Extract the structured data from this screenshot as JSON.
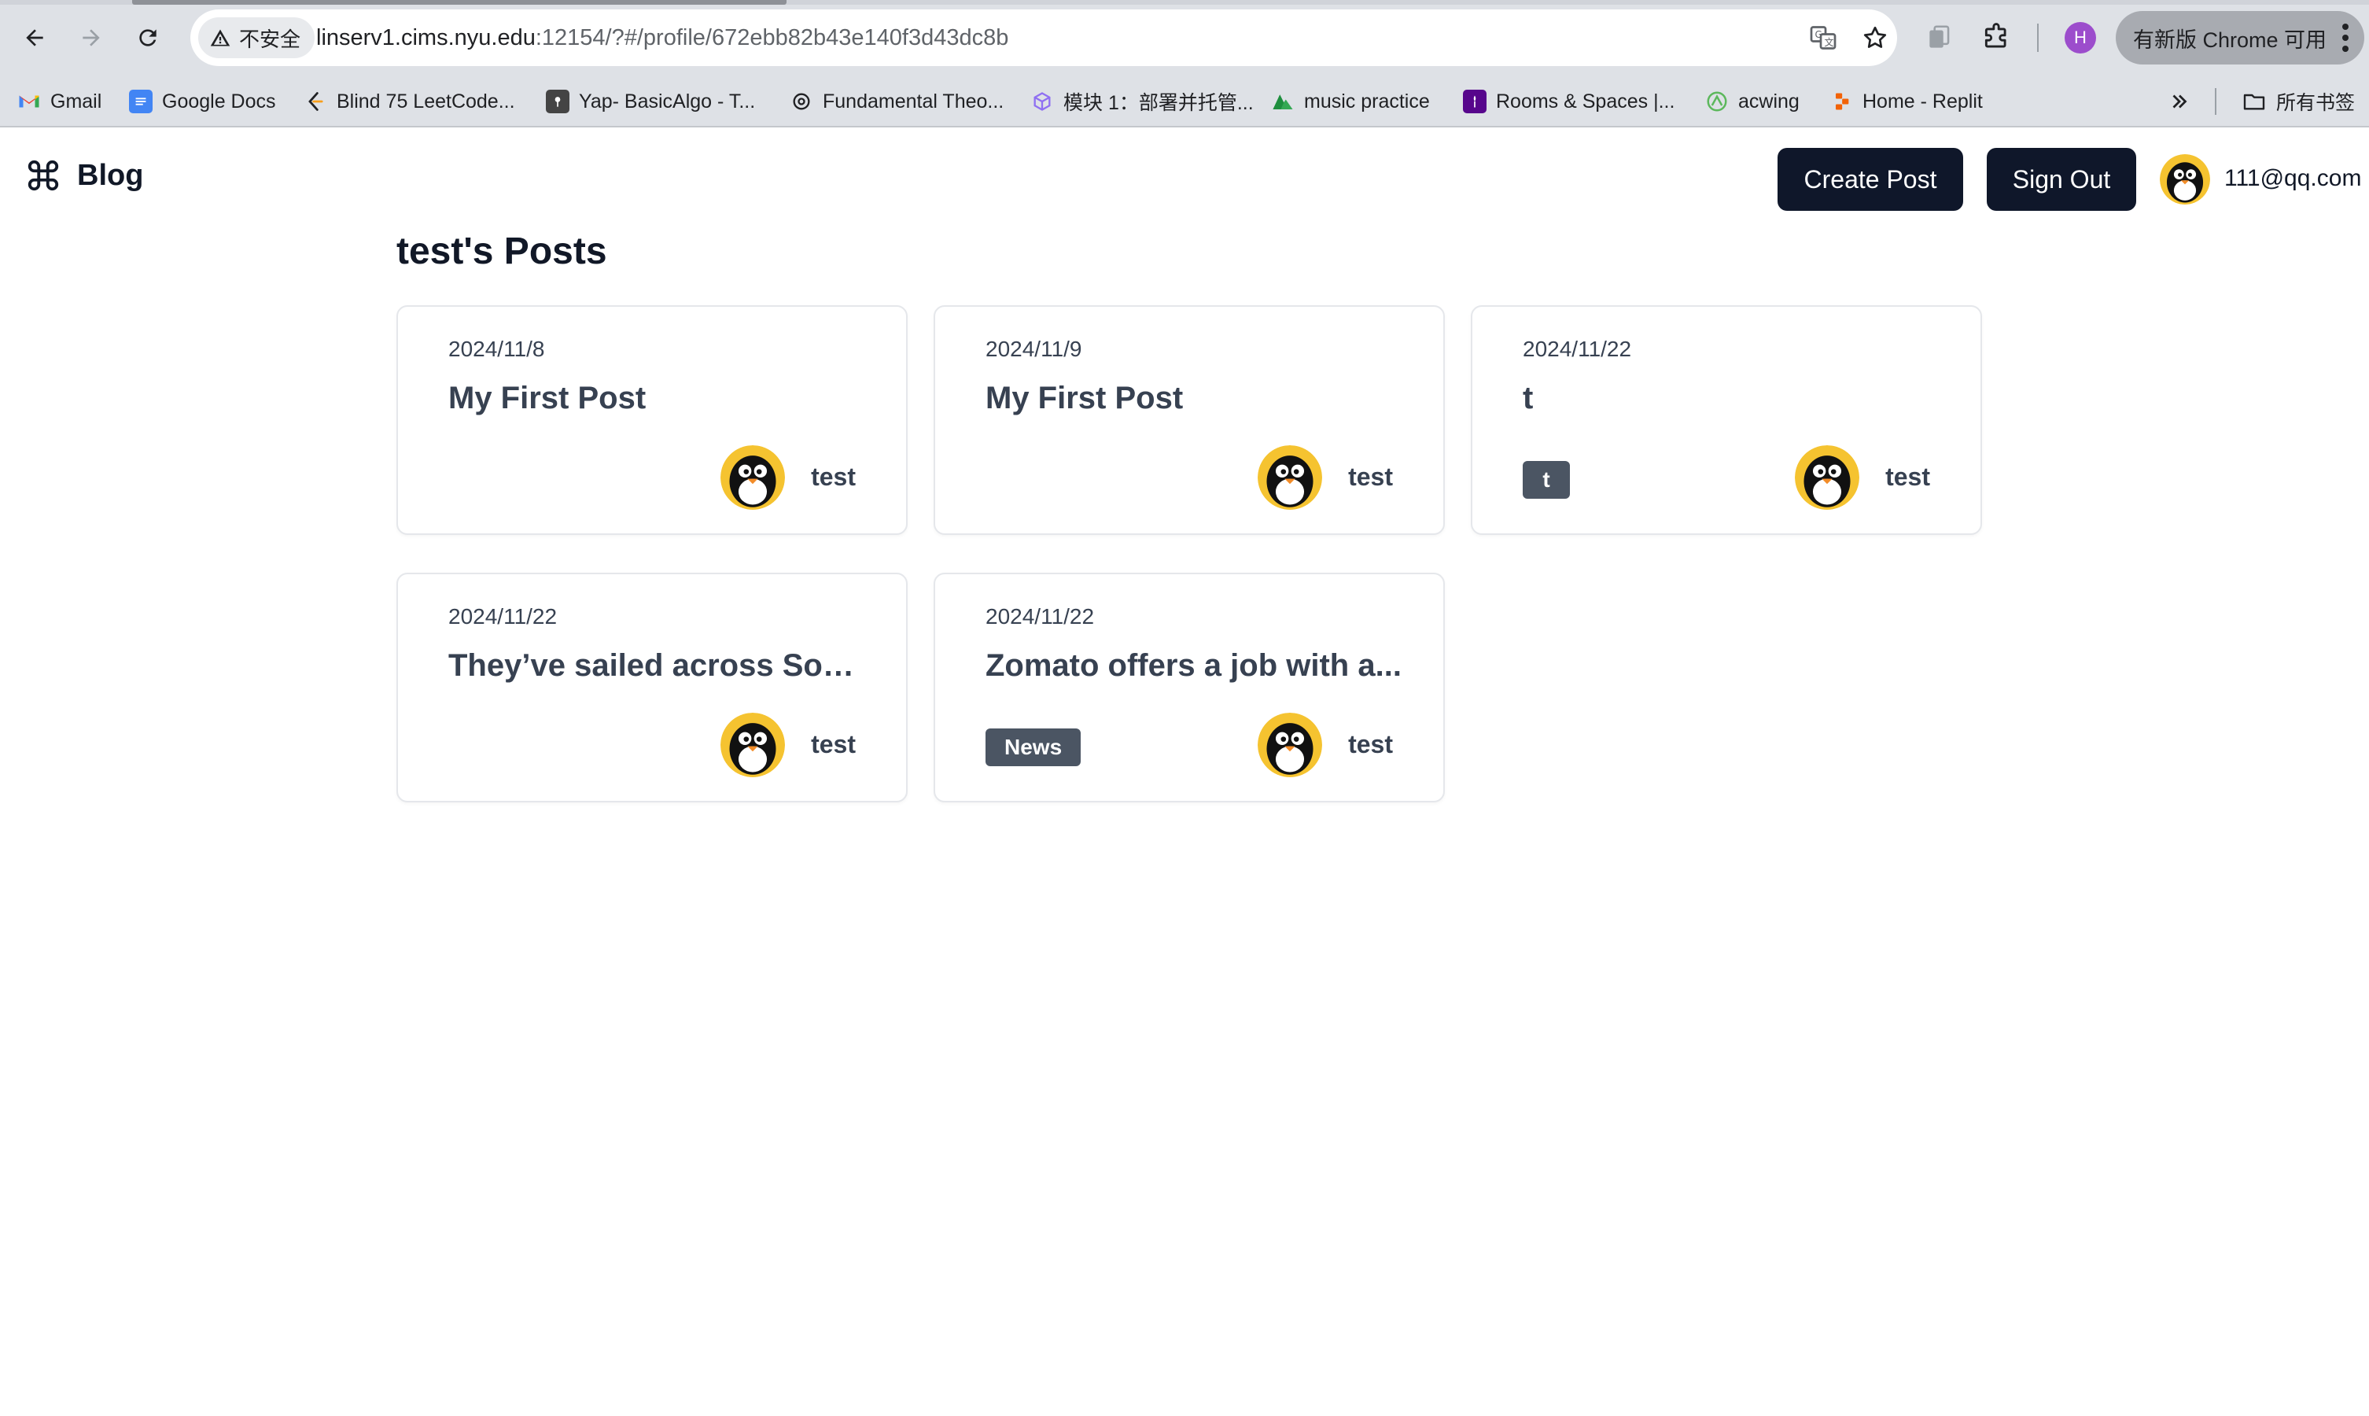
{
  "browser": {
    "security_label": "不安全",
    "url_host": "linserv1.cims.nyu.edu",
    "url_rest": ":12154/?#/profile/672ebb82b43e140f3d43dc8b",
    "profile_initial": "H",
    "update_label": "有新版 Chrome 可用",
    "accent_color": "#9c4dcc"
  },
  "bookmarks": {
    "items": [
      {
        "label": "Gmail",
        "icon": "gmail-icon",
        "color": "#ea4335"
      },
      {
        "label": "Google Docs",
        "icon": "docs-icon",
        "color": "#4285f4"
      },
      {
        "label": "Blind 75 LeetCode...",
        "icon": "leetcode-icon",
        "color": "#f89f1b"
      },
      {
        "label": "Yap- BasicAlgo - T...",
        "icon": "pin-icon",
        "color": "#444444"
      },
      {
        "label": "Fundamental Theo...",
        "icon": "openai-icon",
        "color": "#202124"
      },
      {
        "label": "模块 1：部署并托管...",
        "icon": "cube-icon",
        "color": "#8f6ff2"
      },
      {
        "label": "music practice",
        "icon": "mountain-icon",
        "color": "#34a853"
      },
      {
        "label": "Rooms & Spaces |...",
        "icon": "nyu-icon",
        "color": "#57068c"
      },
      {
        "label": "acwing",
        "icon": "acwing-icon",
        "color": "#5cb85c"
      },
      {
        "label": "Home - Replit",
        "icon": "replit-icon",
        "color": "#f26207"
      }
    ],
    "all_bookmarks_label": "所有书签"
  },
  "header": {
    "logo_text": "Blog",
    "create_post_label": "Create Post",
    "sign_out_label": "Sign Out",
    "user_email": "111@qq.com"
  },
  "main": {
    "title": "test's Posts",
    "posts": [
      {
        "date": "2024/11/8",
        "title": "My First Post",
        "tag": "",
        "author": "test"
      },
      {
        "date": "2024/11/9",
        "title": "My First Post",
        "tag": "",
        "author": "test"
      },
      {
        "date": "2024/11/22",
        "title": "t",
        "tag": "t",
        "author": "test"
      },
      {
        "date": "2024/11/22",
        "title": "They’ve sailed across Sou...",
        "tag": "",
        "author": "test"
      },
      {
        "date": "2024/11/22",
        "title": "Zomato offers a job with a...",
        "tag": "News",
        "author": "test"
      }
    ]
  }
}
